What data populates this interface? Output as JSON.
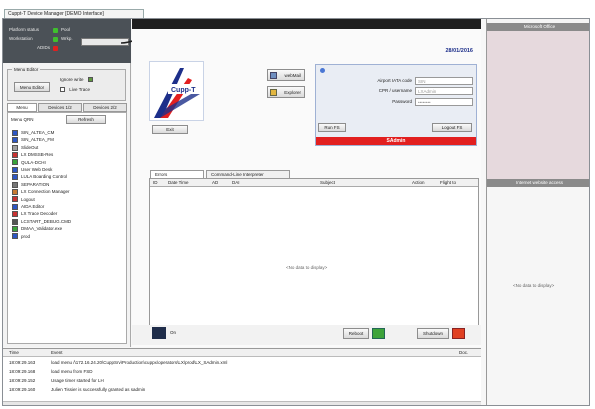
{
  "window_tab": "Cuppt-T Device Manager [DEMO Interface]",
  "status": {
    "rows": [
      {
        "label": "Platform status",
        "value": "Pool",
        "color": "#3fbf2d"
      },
      {
        "label": "Workstation",
        "value": "Wrkp.",
        "color": "#3fbf2d"
      },
      {
        "label": "ADIDs",
        "value": "",
        "color": "#e02020"
      }
    ]
  },
  "menu_editor": {
    "title": "Menu Editor",
    "button": "Menu Editor",
    "options": [
      "Ignore write",
      "Live Trace"
    ]
  },
  "left_tabs": [
    "Menu",
    "Devices 1/2",
    "Devices 2/2"
  ],
  "menu": {
    "title": "Menu QRN",
    "refresh": "Refresh",
    "items": [
      {
        "label": "SIN_ALTEA_CM",
        "icon_color": "#2d56c2"
      },
      {
        "label": "SIN_ALTEA_FM",
        "icon_color": "#2d56c2"
      },
      {
        "label": "SlideOut",
        "icon_color": "#a0a0a0"
      },
      {
        "label": "LX DMSSB-Res",
        "icon_color": "#c83232"
      },
      {
        "label": "QULA-DCHI",
        "icon_color": "#3aa33a"
      },
      {
        "label": "User Web Desk",
        "icon_color": "#2d56c2"
      },
      {
        "label": "LULA Boarding Control",
        "icon_color": "#2d56c2"
      },
      {
        "label": "SEPARATION",
        "icon_color": "#777777"
      },
      {
        "label": "LX Connection Manager",
        "icon_color": "#c87a32"
      },
      {
        "label": "Logout",
        "icon_color": "#c83232"
      },
      {
        "label": "AIDA Editor",
        "icon_color": "#2d56c2"
      },
      {
        "label": "LX Trace Decoder",
        "icon_color": "#c83232"
      },
      {
        "label": "LCSTART_DEBUG.CMD",
        "icon_color": "#555555"
      },
      {
        "label": "DMAA_Validator.exe",
        "icon_color": "#3aa33a"
      },
      {
        "label": "prod",
        "icon_color": "#2d56c2"
      }
    ]
  },
  "header": {
    "date": "28/01/2016"
  },
  "center_buttons": {
    "exit": "Exit",
    "webmail": "webMail",
    "explorer": "Explorer"
  },
  "login": {
    "airport_label": "Airport IATA code",
    "airport_value": "SIN",
    "cpr_label": "CPR / username",
    "cpr_value": "LXAdmin",
    "password_label": "Password",
    "password_value": "••••••••",
    "run_button": "Run FS",
    "logout_button": "Logout FS",
    "status_text": "SAdmin"
  },
  "center_tabs": [
    "Errors",
    "Command-Line Interpreter"
  ],
  "grid": {
    "columns": [
      "ID",
      "Date Time",
      "AD",
      "DAI",
      "Subject",
      "Action",
      "Flight to"
    ],
    "empty": "<No data to display>"
  },
  "bottom": {
    "reboot": "Reboot",
    "shutdown": "Shutdown",
    "on_label": "On"
  },
  "right": {
    "office_title": "Microsoft Office",
    "web_title": "Internet website access",
    "empty": "<No data to display>"
  },
  "log": {
    "columns": [
      "Time",
      "Event",
      "Doc."
    ],
    "rows": [
      {
        "time": "18:09:29.163",
        "event": "load menu /\\172.16.24.20\\CuppSrv\\Production\\cuppx\\operators\\LX\\prod\\LX_SAdmin.xml"
      },
      {
        "time": "18:09:29.168",
        "event": "load menu from FSD"
      },
      {
        "time": "18:09:29.152",
        "event": "Usage timer started for LH"
      },
      {
        "time": "18:09:29.160",
        "event": "Julien Tissier is successfully granted as sadmin"
      }
    ]
  },
  "colors": {
    "accent_red": "#e21f1f",
    "dark_bar": "#1f1f1f",
    "status_bg": "#4b5157",
    "brand_blue": "#1d2f8a"
  }
}
